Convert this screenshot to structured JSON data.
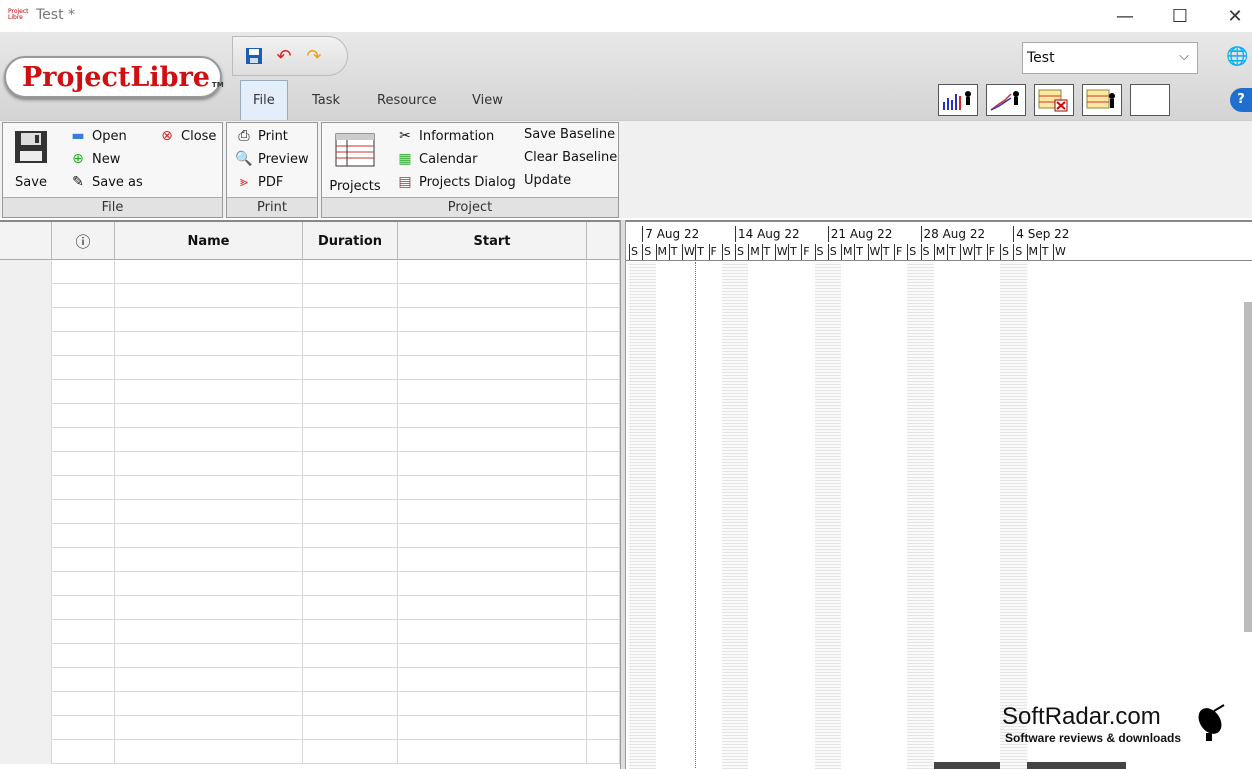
{
  "window": {
    "title": "Test *",
    "app_icon_text": "Project Libre",
    "minimize": "—",
    "maximize": "☐",
    "close": "✕"
  },
  "logo": {
    "text": "ProjectLibre",
    "tm": "TM"
  },
  "tabs": [
    "File",
    "Task",
    "Resource",
    "View"
  ],
  "project_selector": {
    "value": "Test"
  },
  "ribbon": {
    "file": {
      "label": "File",
      "save": "Save",
      "open": "Open",
      "new": "New",
      "save_as": "Save as",
      "close": "Close"
    },
    "print": {
      "label": "Print",
      "print": "Print",
      "preview": "Preview",
      "pdf": "PDF"
    },
    "project": {
      "label": "Project",
      "projects": "Projects",
      "information": "Information",
      "calendar": "Calendar",
      "projects_dialog": "Projects Dialog",
      "save_baseline": "Save Baseline",
      "clear_baseline": "Clear Baseline",
      "update": "Update"
    }
  },
  "grid": {
    "columns": [
      "",
      "ⓘ",
      "Name",
      "Duration",
      "Start"
    ]
  },
  "gantt": {
    "weeks": [
      "7 Aug 22",
      "14 Aug 22",
      "21 Aug 22",
      "28 Aug 22",
      "4 Sep 22"
    ],
    "days": [
      "S",
      "S",
      "M",
      "T",
      "W",
      "T",
      "F",
      "S",
      "S",
      "M",
      "T",
      "W",
      "T",
      "F",
      "S",
      "S",
      "M",
      "T",
      "W",
      "T",
      "F",
      "S",
      "S",
      "M",
      "T",
      "W",
      "T",
      "F",
      "S",
      "S",
      "M",
      "T",
      "W"
    ]
  },
  "watermark": {
    "title": "SoftRadar.com",
    "subtitle": "Software reviews & downloads"
  }
}
